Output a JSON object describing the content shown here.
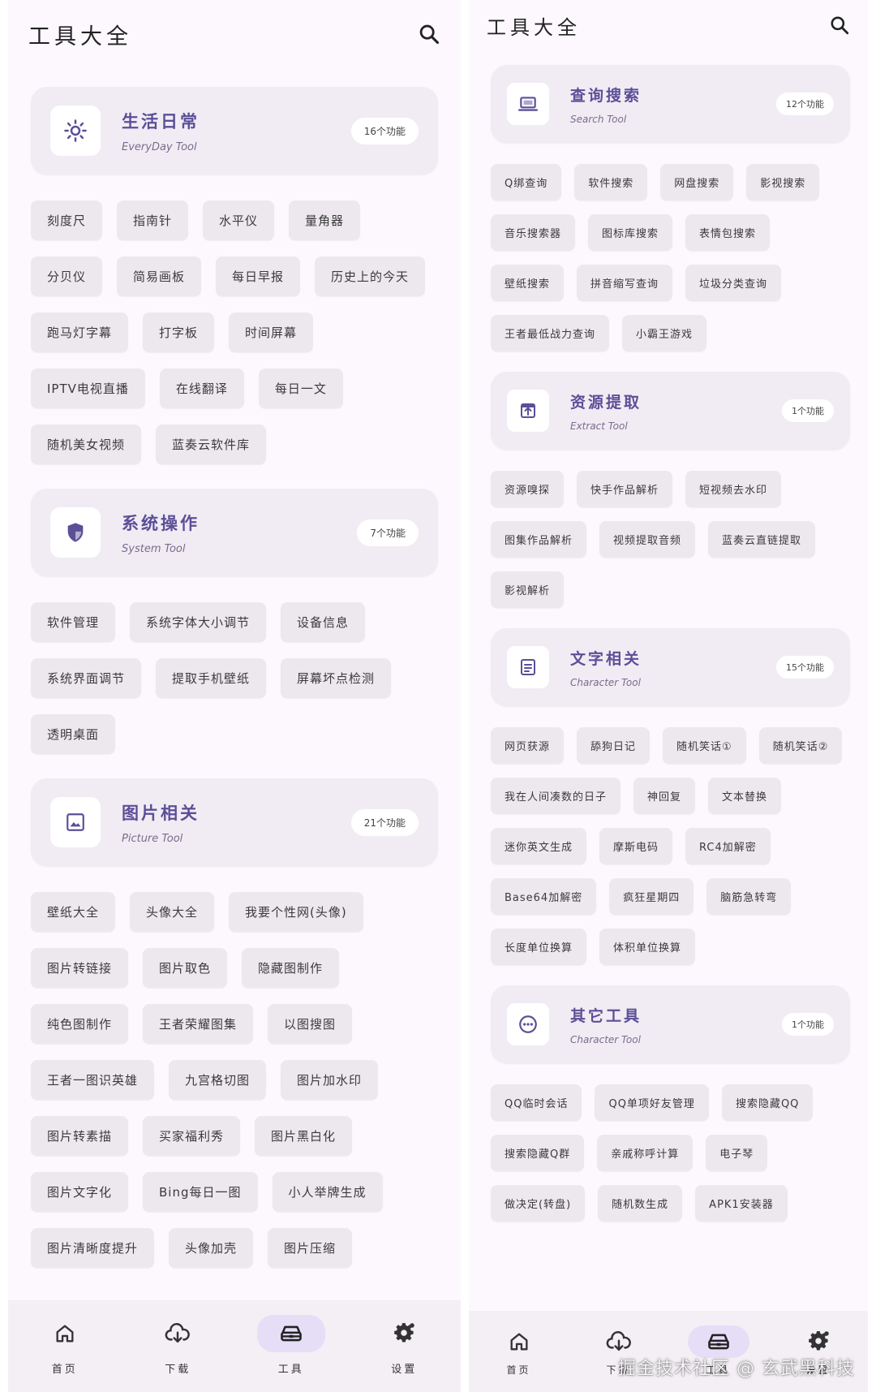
{
  "left": {
    "title": "工具大全",
    "categories": [
      {
        "title": "生活日常",
        "subtitle": "EveryDay Tool",
        "count": "16个功能",
        "icon": "sun-icon",
        "tools": [
          "刻度尺",
          "指南针",
          "水平仪",
          "量角器",
          "分贝仪",
          "简易画板",
          "每日早报",
          "历史上的今天",
          "跑马灯字幕",
          "打字板",
          "时间屏幕",
          "IPTV电视直播",
          "在线翻译",
          "每日一文",
          "随机美女视频",
          "蓝奏云软件库"
        ]
      },
      {
        "title": "系统操作",
        "subtitle": "System Tool",
        "count": "7个功能",
        "icon": "shield-icon",
        "tools": [
          "软件管理",
          "系统字体大小调节",
          "设备信息",
          "系统界面调节",
          "提取手机壁纸",
          "屏幕坏点检测",
          "透明桌面"
        ]
      },
      {
        "title": "图片相关",
        "subtitle": "Picture Tool",
        "count": "21个功能",
        "icon": "image-icon",
        "tools": [
          "壁纸大全",
          "头像大全",
          "我要个性网(头像)",
          "图片转链接",
          "图片取色",
          "隐藏图制作",
          "纯色图制作",
          "王者荣耀图集",
          "以图搜图",
          "王者一图识英雄",
          "九宫格切图",
          "图片加水印",
          "图片转素描",
          "买家福利秀",
          "图片黑白化",
          "图片文字化",
          "Bing每日一图",
          "小人举牌生成",
          "图片清晰度提升",
          "头像加壳",
          "图片压缩"
        ]
      }
    ],
    "nav": [
      {
        "label": "首页",
        "icon": "home-icon",
        "active": false
      },
      {
        "label": "下载",
        "icon": "cloud-download-icon",
        "active": false
      },
      {
        "label": "工具",
        "icon": "toolbox-icon",
        "active": true
      },
      {
        "label": "设置",
        "icon": "gear-icon",
        "active": false
      }
    ]
  },
  "right": {
    "title": "工具大全",
    "categories": [
      {
        "title": "查询搜索",
        "subtitle": "Search Tool",
        "count": "12个功能",
        "icon": "laptop-icon",
        "tools": [
          "Q绑查询",
          "软件搜索",
          "网盘搜索",
          "影视搜索",
          "音乐搜索器",
          "图标库搜索",
          "表情包搜索",
          "壁纸搜索",
          "拼音缩写查询",
          "垃圾分类查询",
          "王者最低战力查询",
          "小霸王游戏"
        ]
      },
      {
        "title": "资源提取",
        "subtitle": "Extract Tool",
        "count": "1个功能",
        "icon": "extract-icon",
        "tools": [
          "资源嗅探",
          "快手作品解析",
          "短视频去水印",
          "图集作品解析",
          "视频提取音频",
          "蓝奏云直链提取",
          "影视解析"
        ]
      },
      {
        "title": "文字相关",
        "subtitle": "Character Tool",
        "count": "15个功能",
        "icon": "document-icon",
        "tools": [
          "网页获源",
          "舔狗日记",
          "随机笑话①",
          "随机笑话②",
          "我在人间凑数的日子",
          "神回复",
          "文本替换",
          "迷你英文生成",
          "摩斯电码",
          "RC4加解密",
          "Base64加解密",
          "疯狂星期四",
          "脑筋急转弯",
          "长度单位换算",
          "体积单位换算"
        ]
      },
      {
        "title": "其它工具",
        "subtitle": "Character Tool",
        "count": "1个功能",
        "icon": "more-icon",
        "tools": [
          "QQ临时会话",
          "QQ单项好友管理",
          "搜索隐藏QQ",
          "搜索隐藏Q群",
          "亲戚称呼计算",
          "电子琴",
          "做决定(转盘)",
          "随机数生成",
          "APK1安装器"
        ]
      }
    ],
    "nav": [
      {
        "label": "首页",
        "icon": "home-icon",
        "active": false
      },
      {
        "label": "下载",
        "icon": "cloud-download-icon",
        "active": false
      },
      {
        "label": "工具",
        "icon": "toolbox-icon",
        "active": true
      },
      {
        "label": "设置",
        "icon": "gear-icon",
        "active": false
      }
    ]
  },
  "watermark": "掘金技术社区 @ 玄武黑科技",
  "colors": {
    "accent": "#5b4f98",
    "card_bg": "#f1ecf3",
    "chip_bg": "#ede8ee",
    "page_bg": "#fcf8fd",
    "nav_active": "#e6def7"
  }
}
